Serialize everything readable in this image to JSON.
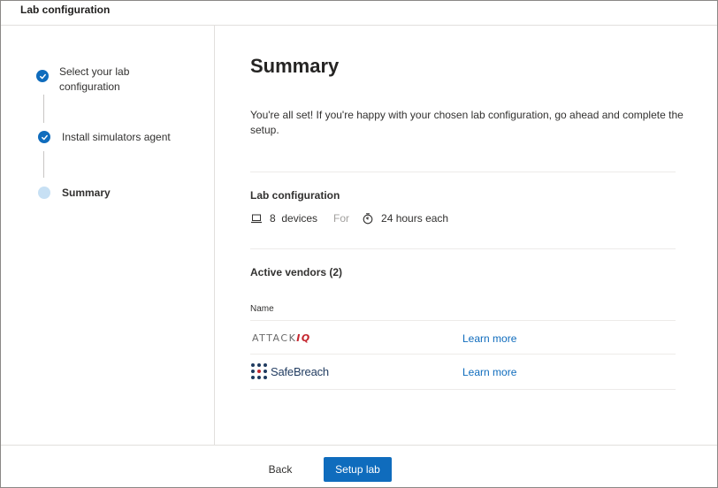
{
  "window": {
    "title": "Lab configuration"
  },
  "stepper": {
    "steps": [
      {
        "label": "Select your lab configuration",
        "state": "done"
      },
      {
        "label": "Install simulators agent",
        "state": "done"
      },
      {
        "label": "Summary",
        "state": "current"
      }
    ]
  },
  "main": {
    "title": "Summary",
    "intro": "You're all set! If you're happy with your chosen lab configuration, go ahead and complete the setup.",
    "lab_config": {
      "heading": "Lab configuration",
      "devices": "8  devices",
      "for_label": "For",
      "duration": "24 hours each",
      "device_icon": "laptop-icon",
      "duration_icon": "timer-icon"
    },
    "vendors": {
      "heading": "Active vendors (2)",
      "column_name": "Name",
      "rows": [
        {
          "logo_text": "ATTACK",
          "logo_accent": "IQ",
          "link": "Learn more"
        },
        {
          "logo_text": "SafeBreach",
          "link": "Learn more"
        }
      ]
    }
  },
  "footer": {
    "back_label": "Back",
    "setup_label": "Setup lab"
  },
  "colors": {
    "accent": "#0f6cbd",
    "attackiq_red": "#c4262e",
    "safebreach_navy": "#1f3a5f"
  }
}
